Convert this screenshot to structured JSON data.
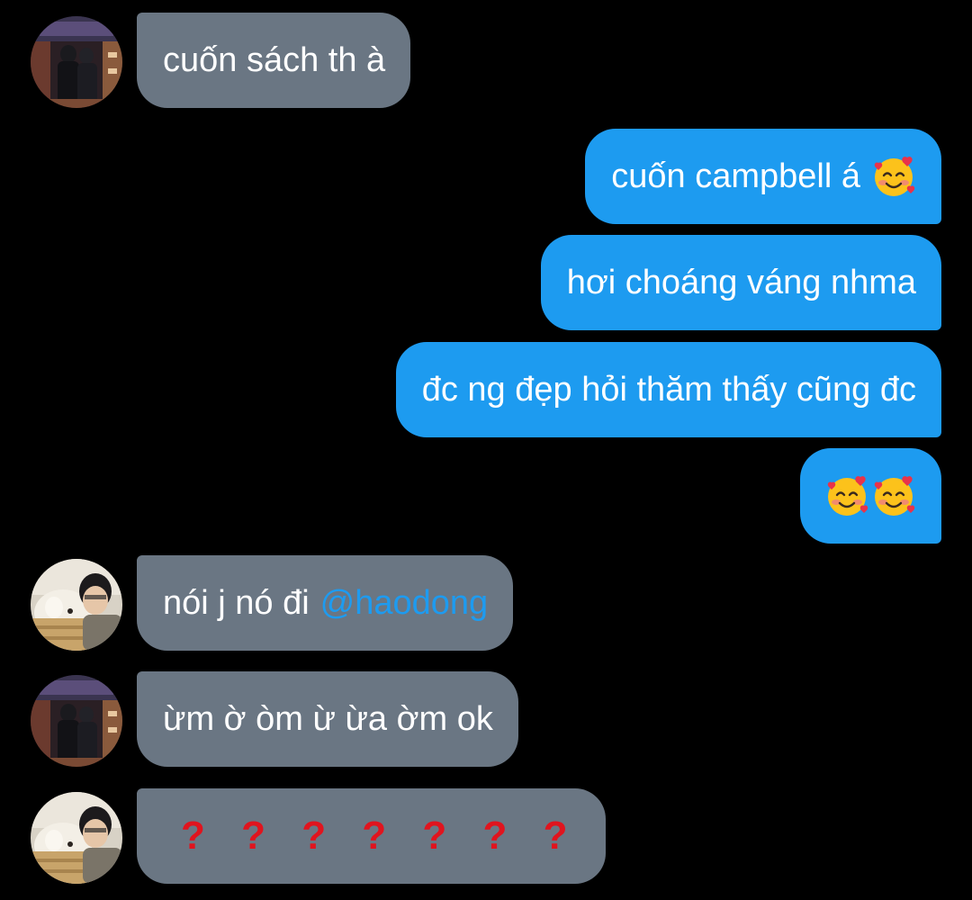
{
  "messages": [
    {
      "side": "in",
      "avatar": "couple-photo-avatar",
      "text": "cuốn sách th à"
    },
    {
      "side": "out",
      "text": "cuốn campbell á",
      "emoji": "smiling-face-with-hearts"
    },
    {
      "side": "out",
      "text": "hơi choáng váng nhma"
    },
    {
      "side": "out",
      "text": "đc ng đẹp hỏi thăm thấy cũng đc"
    },
    {
      "side": "out",
      "emoji_only": [
        "smiling-face-with-hearts",
        "smiling-face-with-hearts"
      ]
    },
    {
      "side": "in",
      "avatar": "boy-with-dog-avatar",
      "text": "nói j nó đi",
      "mention": "@haodong"
    },
    {
      "side": "in",
      "avatar": "couple-photo-avatar",
      "text": "ừm ờ òm ừ ừa ờm ok"
    },
    {
      "side": "in",
      "avatar": "boy-with-dog-avatar",
      "text": "? ? ? ? ? ? ?"
    }
  ],
  "colors": {
    "background": "#000000",
    "incoming_bubble": "#6a7683",
    "outgoing_bubble": "#1d9bf0",
    "mention": "#1d9bf0",
    "question_marks": "#e0141e"
  }
}
